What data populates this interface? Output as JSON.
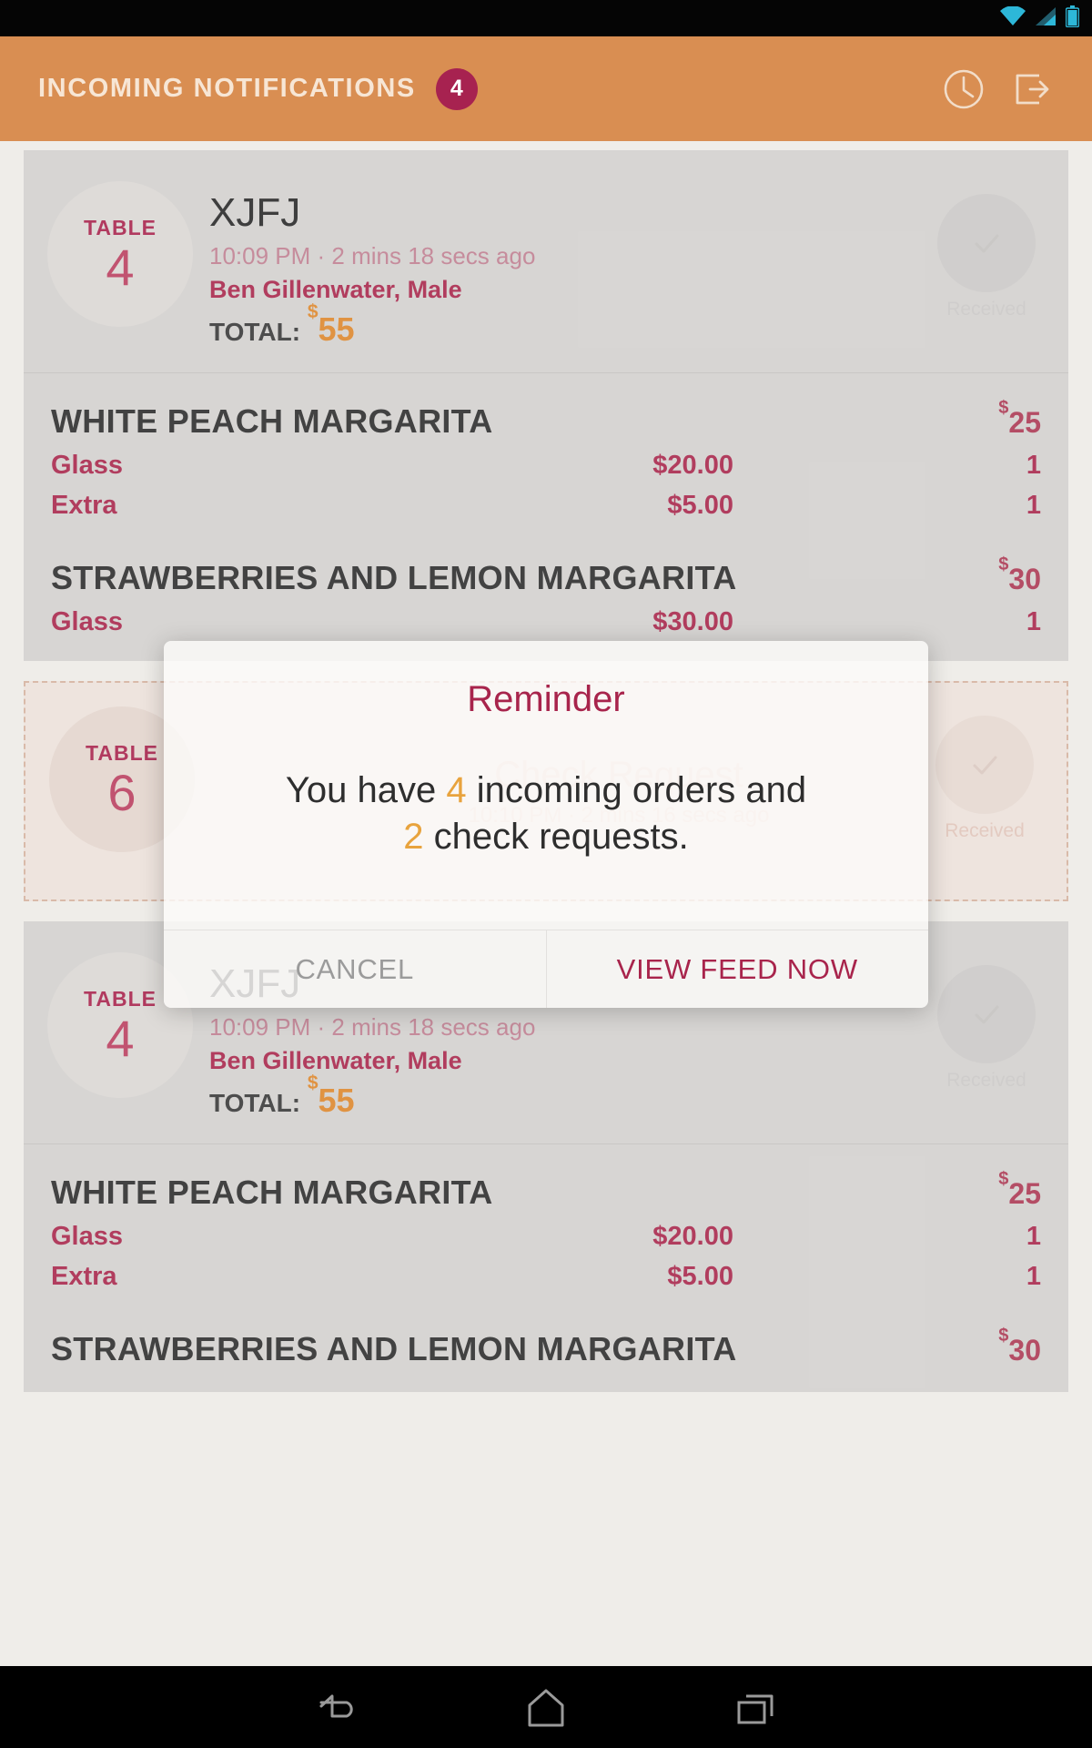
{
  "status_bar": {
    "icons": [
      "wifi-icon",
      "cellular-signal-icon",
      "battery-icon"
    ],
    "icon_color": "#29b6d8"
  },
  "appbar": {
    "title": "INCOMING NOTIFICATIONS",
    "badge_count": "4",
    "background_color": "#d98c4f",
    "title_color": "#f7e6d5",
    "badge_color": "#a61e4d",
    "actions": [
      {
        "name": "clock-icon"
      },
      {
        "name": "logout-icon"
      }
    ]
  },
  "feed": {
    "cards": [
      {
        "type": "order",
        "table_word": "TABLE",
        "table_number": "4",
        "order_code": "XJFJ",
        "time": "10:09 PM · 2 mins 18 secs ago",
        "customer": "Ben Gillenwater, Male",
        "total_label": "TOTAL:",
        "total_currency": "$",
        "total_amount": "55",
        "received_label": "Received",
        "items": [
          {
            "name": "WHITE PEACH MARGARITA",
            "currency": "$",
            "price": "25",
            "options": [
              {
                "name": "Glass",
                "price": "$20.00",
                "qty": "1"
              },
              {
                "name": "Extra",
                "price": "$5.00",
                "qty": "1"
              }
            ]
          },
          {
            "name": "STRAWBERRIES AND LEMON MARGARITA",
            "currency": "$",
            "price": "30",
            "options": [
              {
                "name": "Glass",
                "price": "$30.00",
                "qty": "1"
              }
            ]
          }
        ]
      },
      {
        "type": "check_request",
        "table_word": "TABLE",
        "table_number": "6",
        "title": "Check Request",
        "time": "10:10 PM · 2 mins 16 secs ago",
        "received_label": "Received"
      },
      {
        "type": "order",
        "table_word": "TABLE",
        "table_number": "4",
        "order_code": "XJFJ",
        "time": "10:09 PM · 2 mins 18 secs ago",
        "customer": "Ben Gillenwater, Male",
        "total_label": "TOTAL:",
        "total_currency": "$",
        "total_amount": "55",
        "received_label": "Received",
        "items": [
          {
            "name": "WHITE PEACH MARGARITA",
            "currency": "$",
            "price": "25",
            "options": [
              {
                "name": "Glass",
                "price": "$20.00",
                "qty": "1"
              },
              {
                "name": "Extra",
                "price": "$5.00",
                "qty": "1"
              }
            ]
          },
          {
            "name": "STRAWBERRIES AND LEMON MARGARITA",
            "currency": "$",
            "price": "30",
            "options": []
          }
        ]
      }
    ]
  },
  "dialog": {
    "title": "Reminder",
    "message_part1": "You have ",
    "message_count1": "4",
    "message_part2": " incoming orders and",
    "message_count2": "2",
    "message_part3": " check requests.",
    "cancel_label": "CANCEL",
    "confirm_label": "VIEW FEED NOW",
    "title_color": "#a8244c",
    "highlight_color": "#e8a33d"
  },
  "navbar": {
    "buttons": [
      {
        "name": "back-button"
      },
      {
        "name": "home-button"
      },
      {
        "name": "recents-button"
      }
    ]
  }
}
